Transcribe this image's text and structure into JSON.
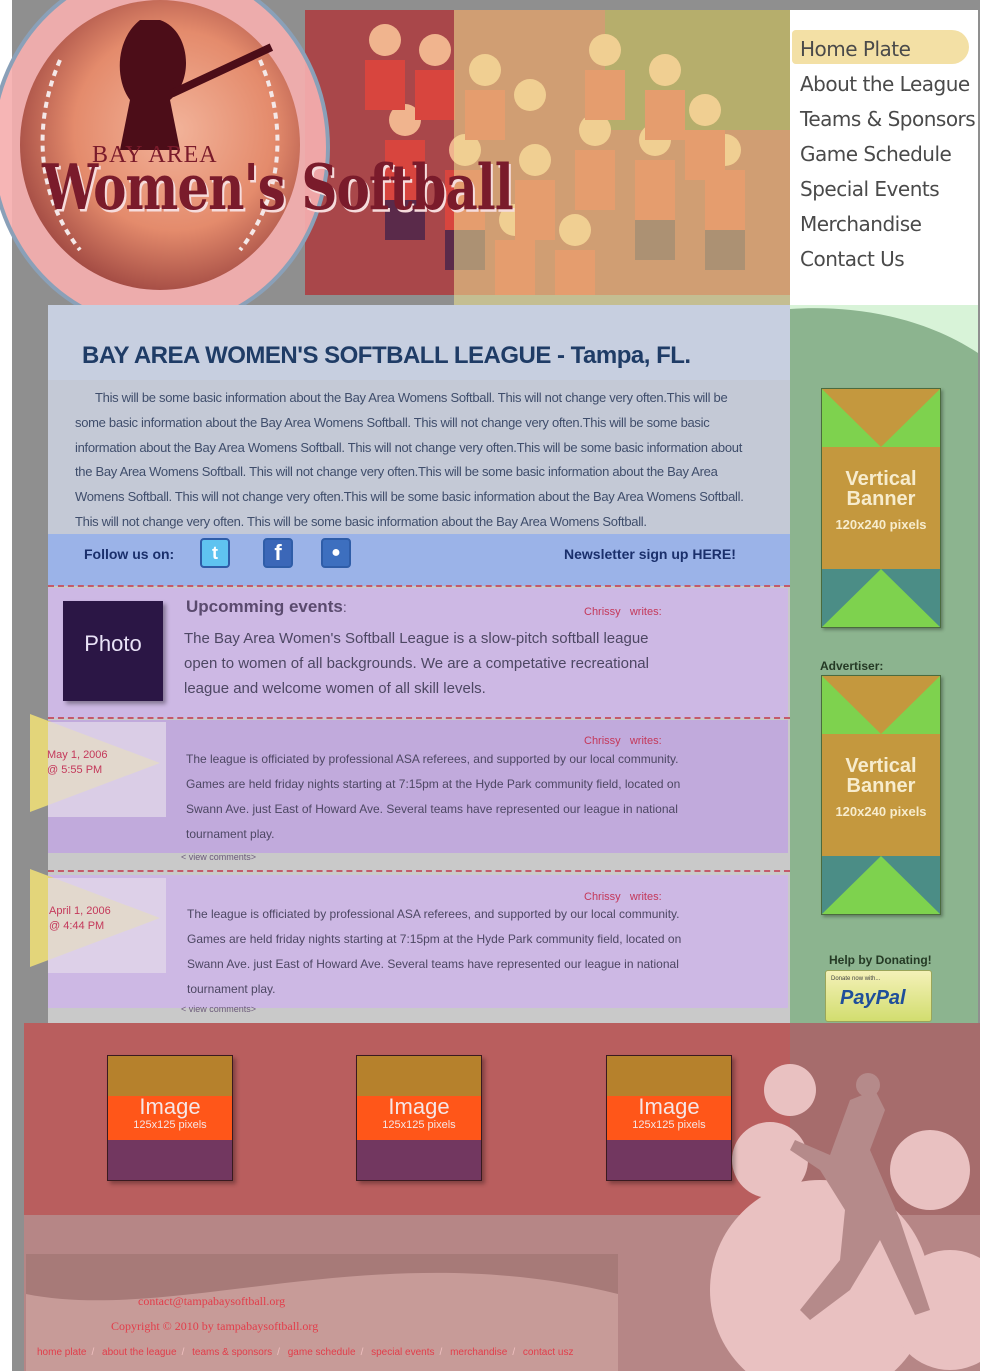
{
  "brand": {
    "logo_line1": "BAY AREA",
    "logo_line2": "Women's Softball"
  },
  "nav": {
    "items": [
      {
        "label": "Home Plate",
        "active": true
      },
      {
        "label": "About the League"
      },
      {
        "label": "Teams & Sponsors"
      },
      {
        "label": "Game Schedule"
      },
      {
        "label": "Special Events"
      },
      {
        "label": "Merchandise"
      },
      {
        "label": "Contact Us"
      }
    ]
  },
  "intro": {
    "title": "BAY AREA  WOMEN'S  SOFTBALL LEAGUE - Tampa, FL.",
    "body": "This will be some basic information about the Bay Area Womens Softball.  This will not change very often.This will be some basic information about the Bay Area Womens Softball.  This will not change very often.This will be some basic information about the Bay Area Womens Softball.  This will not change very often.This will be some basic information about the Bay Area Womens Softball.  This will not change very often.This will be some basic information about the Bay Area Womens Softball.  This will not change very often.This will be some basic information about the Bay Area Womens Softball.  This will not change very often. This will be some basic information about the Bay Area Womens Softball."
  },
  "social": {
    "follow_label": "Follow us on:",
    "icons": [
      "twitter-icon",
      "facebook-icon",
      "myspace-icon"
    ],
    "newsletter_label": "Newsletter sign up HERE!"
  },
  "events": {
    "heading": "Upcomming events",
    "heading_colon": ":",
    "author": "Chrissy",
    "writes": "writes:",
    "photo_label": "Photo",
    "lead": "The Bay Area Women's Softball League is a slow-pitch softball league open to women of all backgrounds. We are a competative recreational league and welcome women of all skill levels.",
    "posts": [
      {
        "date": "May 1, 2006",
        "time": "@ 5:55 PM",
        "author": "Chrissy",
        "writes": "writes:",
        "text": "The league is officiated by professional ASA referees, and supported by our local community. Games are held friday nights starting at 7:15pm at the Hyde Park community field, located on Swann Ave. just East of Howard Ave. Several teams have represented our league in national tournament play.",
        "comments_link": "< view comments>"
      },
      {
        "date": "April 1, 2006",
        "time": "@ 4:44 PM",
        "author": "Chrissy",
        "writes": "writes:",
        "text": "The league is officiated by professional ASA referees, and supported by our local community. Games are held friday nights starting at 7:15pm at the Hyde Park community field, located on Swann Ave. just East of Howard Ave. Several teams have represented our league in national tournament play.",
        "comments_link": "< view comments>"
      }
    ]
  },
  "sidebar": {
    "banners": [
      {
        "line1": "Vertical",
        "line2": "Banner",
        "size": "120x240 pixels"
      },
      {
        "line1": "Vertical",
        "line2": "Banner",
        "size": "120x240 pixels"
      }
    ],
    "advertiser_label": "Advertiser:",
    "donate_label": "Help by Donating!",
    "paypal_small": "Donate now with...",
    "paypal_logo": "PayPal"
  },
  "footer": {
    "images": [
      {
        "label": "Image",
        "size": "125x125 pixels"
      },
      {
        "label": "Image",
        "size": "125x125 pixels"
      },
      {
        "label": "Image",
        "size": "125x125 pixels"
      }
    ],
    "contact_email": "contact@tampabaysoftball.org",
    "copyright": "Copyright © 2010 by tampabaysoftball.org",
    "links": [
      "home plate",
      "about the league",
      "teams & sponsors",
      "game schedule",
      "special events",
      "merchandise",
      "contact usz"
    ],
    "link_separator": "/"
  },
  "colors": {
    "title_blue": "#1f3c66",
    "link_red": "#e23d4a",
    "author_red": "#c4385a",
    "sidebar_green": "#8cb48f"
  }
}
